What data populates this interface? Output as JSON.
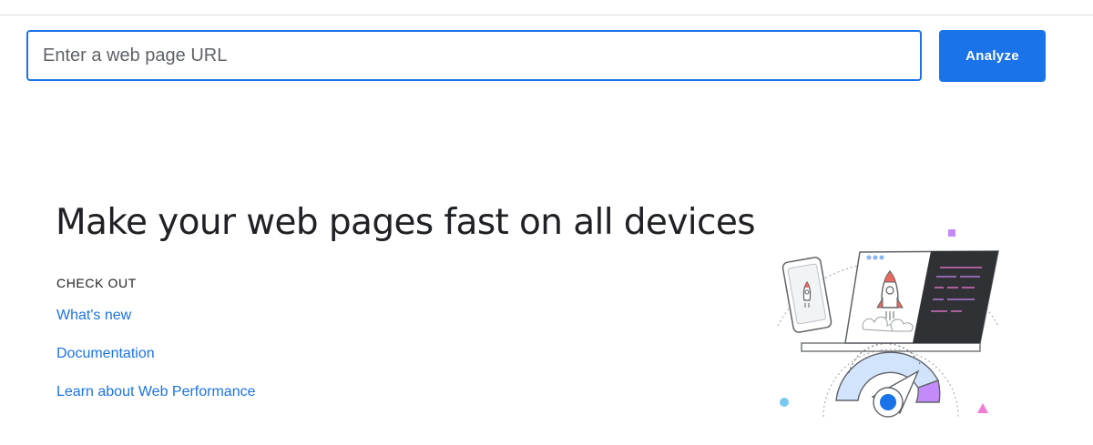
{
  "search": {
    "placeholder": "Enter a web page URL",
    "button_label": "Analyze"
  },
  "hero": {
    "title": "Make your web pages fast on all devices"
  },
  "checkout": {
    "heading": "CHECK OUT",
    "links": [
      {
        "label": "What's new"
      },
      {
        "label": "Documentation"
      },
      {
        "label": "Learn about Web Performance"
      }
    ]
  },
  "theme": {
    "accent": "#1a73e8",
    "text": "#202124",
    "gauge_fill": "#d2e3fc",
    "gauge_score": "#c58af9",
    "code_panel": "#303134",
    "rocket_accent": "#ee675c"
  }
}
